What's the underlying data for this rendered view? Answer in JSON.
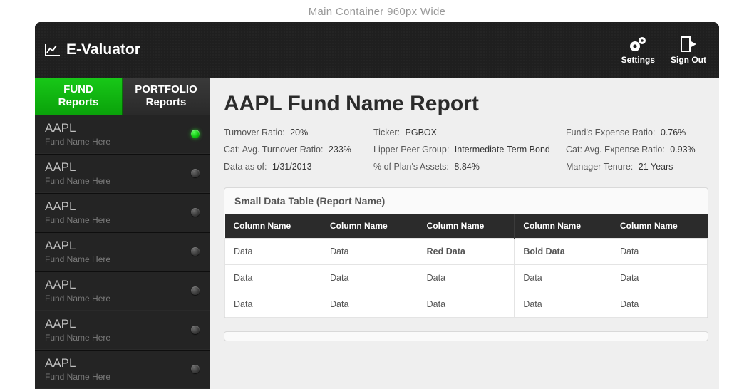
{
  "container_label": "Main Container 960px Wide",
  "brand": {
    "name": "E-Valuator"
  },
  "topbar": {
    "settings_label": "Settings",
    "signout_label": "Sign Out"
  },
  "sidebar": {
    "tabs": [
      {
        "label": "FUND\nReports",
        "active": true
      },
      {
        "label": "PORTFOLIO\nReports",
        "active": false
      }
    ],
    "items": [
      {
        "ticker": "AAPL",
        "name": "Fund Name Here",
        "selected": true
      },
      {
        "ticker": "AAPL",
        "name": "Fund Name Here",
        "selected": false
      },
      {
        "ticker": "AAPL",
        "name": "Fund Name Here",
        "selected": false
      },
      {
        "ticker": "AAPL",
        "name": "Fund Name Here",
        "selected": false
      },
      {
        "ticker": "AAPL",
        "name": "Fund Name Here",
        "selected": false
      },
      {
        "ticker": "AAPL",
        "name": "Fund Name Here",
        "selected": false
      },
      {
        "ticker": "AAPL",
        "name": "Fund Name Here",
        "selected": false
      }
    ]
  },
  "main": {
    "title": "AAPL Fund Name Report",
    "meta": [
      [
        {
          "label": "Turnover Ratio:",
          "value": "20%"
        },
        {
          "label": "Ticker:",
          "value": "PGBOX"
        },
        {
          "label": "Fund's Expense Ratio:",
          "value": "0.76%"
        }
      ],
      [
        {
          "label": "Cat: Avg. Turnover Ratio:",
          "value": "233%"
        },
        {
          "label": "Lipper Peer Group:",
          "value": "Intermediate-Term Bond"
        },
        {
          "label": "Cat: Avg. Expense Ratio:",
          "value": "0.93%"
        }
      ],
      [
        {
          "label": "Data as of:",
          "value": "1/31/2013"
        },
        {
          "label": "% of Plan's Assets:",
          "value": "8.84%"
        },
        {
          "label": "Manager Tenure:",
          "value": "21 Years"
        }
      ]
    ],
    "table": {
      "title": "Small Data Table (Report Name)",
      "columns": [
        "Column Name",
        "Column Name",
        "Column Name",
        "Column Name",
        "Column Name"
      ],
      "rows": [
        [
          {
            "text": "Data"
          },
          {
            "text": "Data"
          },
          {
            "text": "Red Data",
            "style": "red"
          },
          {
            "text": "Bold Data",
            "style": "bold"
          },
          {
            "text": "Data"
          }
        ],
        [
          {
            "text": "Data"
          },
          {
            "text": "Data"
          },
          {
            "text": "Data"
          },
          {
            "text": "Data"
          },
          {
            "text": "Data"
          }
        ],
        [
          {
            "text": "Data"
          },
          {
            "text": "Data"
          },
          {
            "text": "Data"
          },
          {
            "text": "Data"
          },
          {
            "text": "Data"
          }
        ]
      ]
    }
  }
}
